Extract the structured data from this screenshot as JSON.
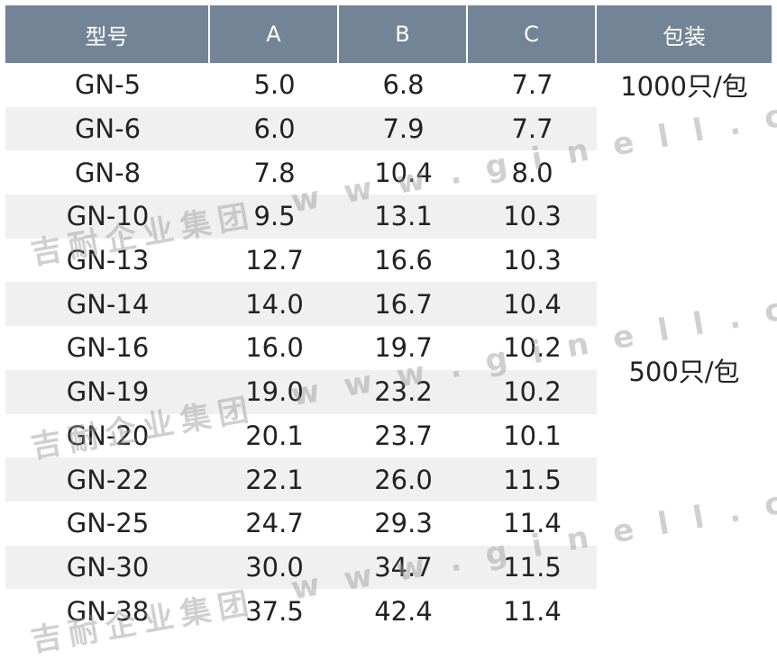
{
  "header": [
    "型号",
    "A",
    "B",
    "C",
    "包装"
  ],
  "rows": [
    [
      "GN-5",
      "5.0",
      "6.8",
      "7.7"
    ],
    [
      "GN-6",
      "6.0",
      "7.9",
      "7.7"
    ],
    [
      "GN-8",
      "7.8",
      "10.4",
      "8.0"
    ],
    [
      "GN-10",
      "9.5",
      "13.1",
      "10.3"
    ],
    [
      "GN-13",
      "12.7",
      "16.6",
      "10.3"
    ],
    [
      "GN-14",
      "14.0",
      "16.7",
      "10.4"
    ],
    [
      "GN-16",
      "16.0",
      "19.7",
      "10.2"
    ],
    [
      "GN-19",
      "19.0",
      "23.2",
      "10.2"
    ],
    [
      "GN-20",
      "20.1",
      "23.7",
      "10.1"
    ],
    [
      "GN-22",
      "22.1",
      "26.0",
      "11.5"
    ],
    [
      "GN-25",
      "24.7",
      "29.3",
      "11.4"
    ],
    [
      "GN-30",
      "30.0",
      "34.7",
      "11.5"
    ],
    [
      "GN-38",
      "37.5",
      "42.4",
      "11.4"
    ]
  ],
  "packaging": {
    "first": "1000只/包",
    "rest": "500只/包"
  },
  "watermark": {
    "company": "吉耐企业集团",
    "url": "w w w . g i n e l l . c o m . c n"
  },
  "colors": {
    "header_bg": "#738497",
    "shaded_row": "#f0f0f0"
  }
}
